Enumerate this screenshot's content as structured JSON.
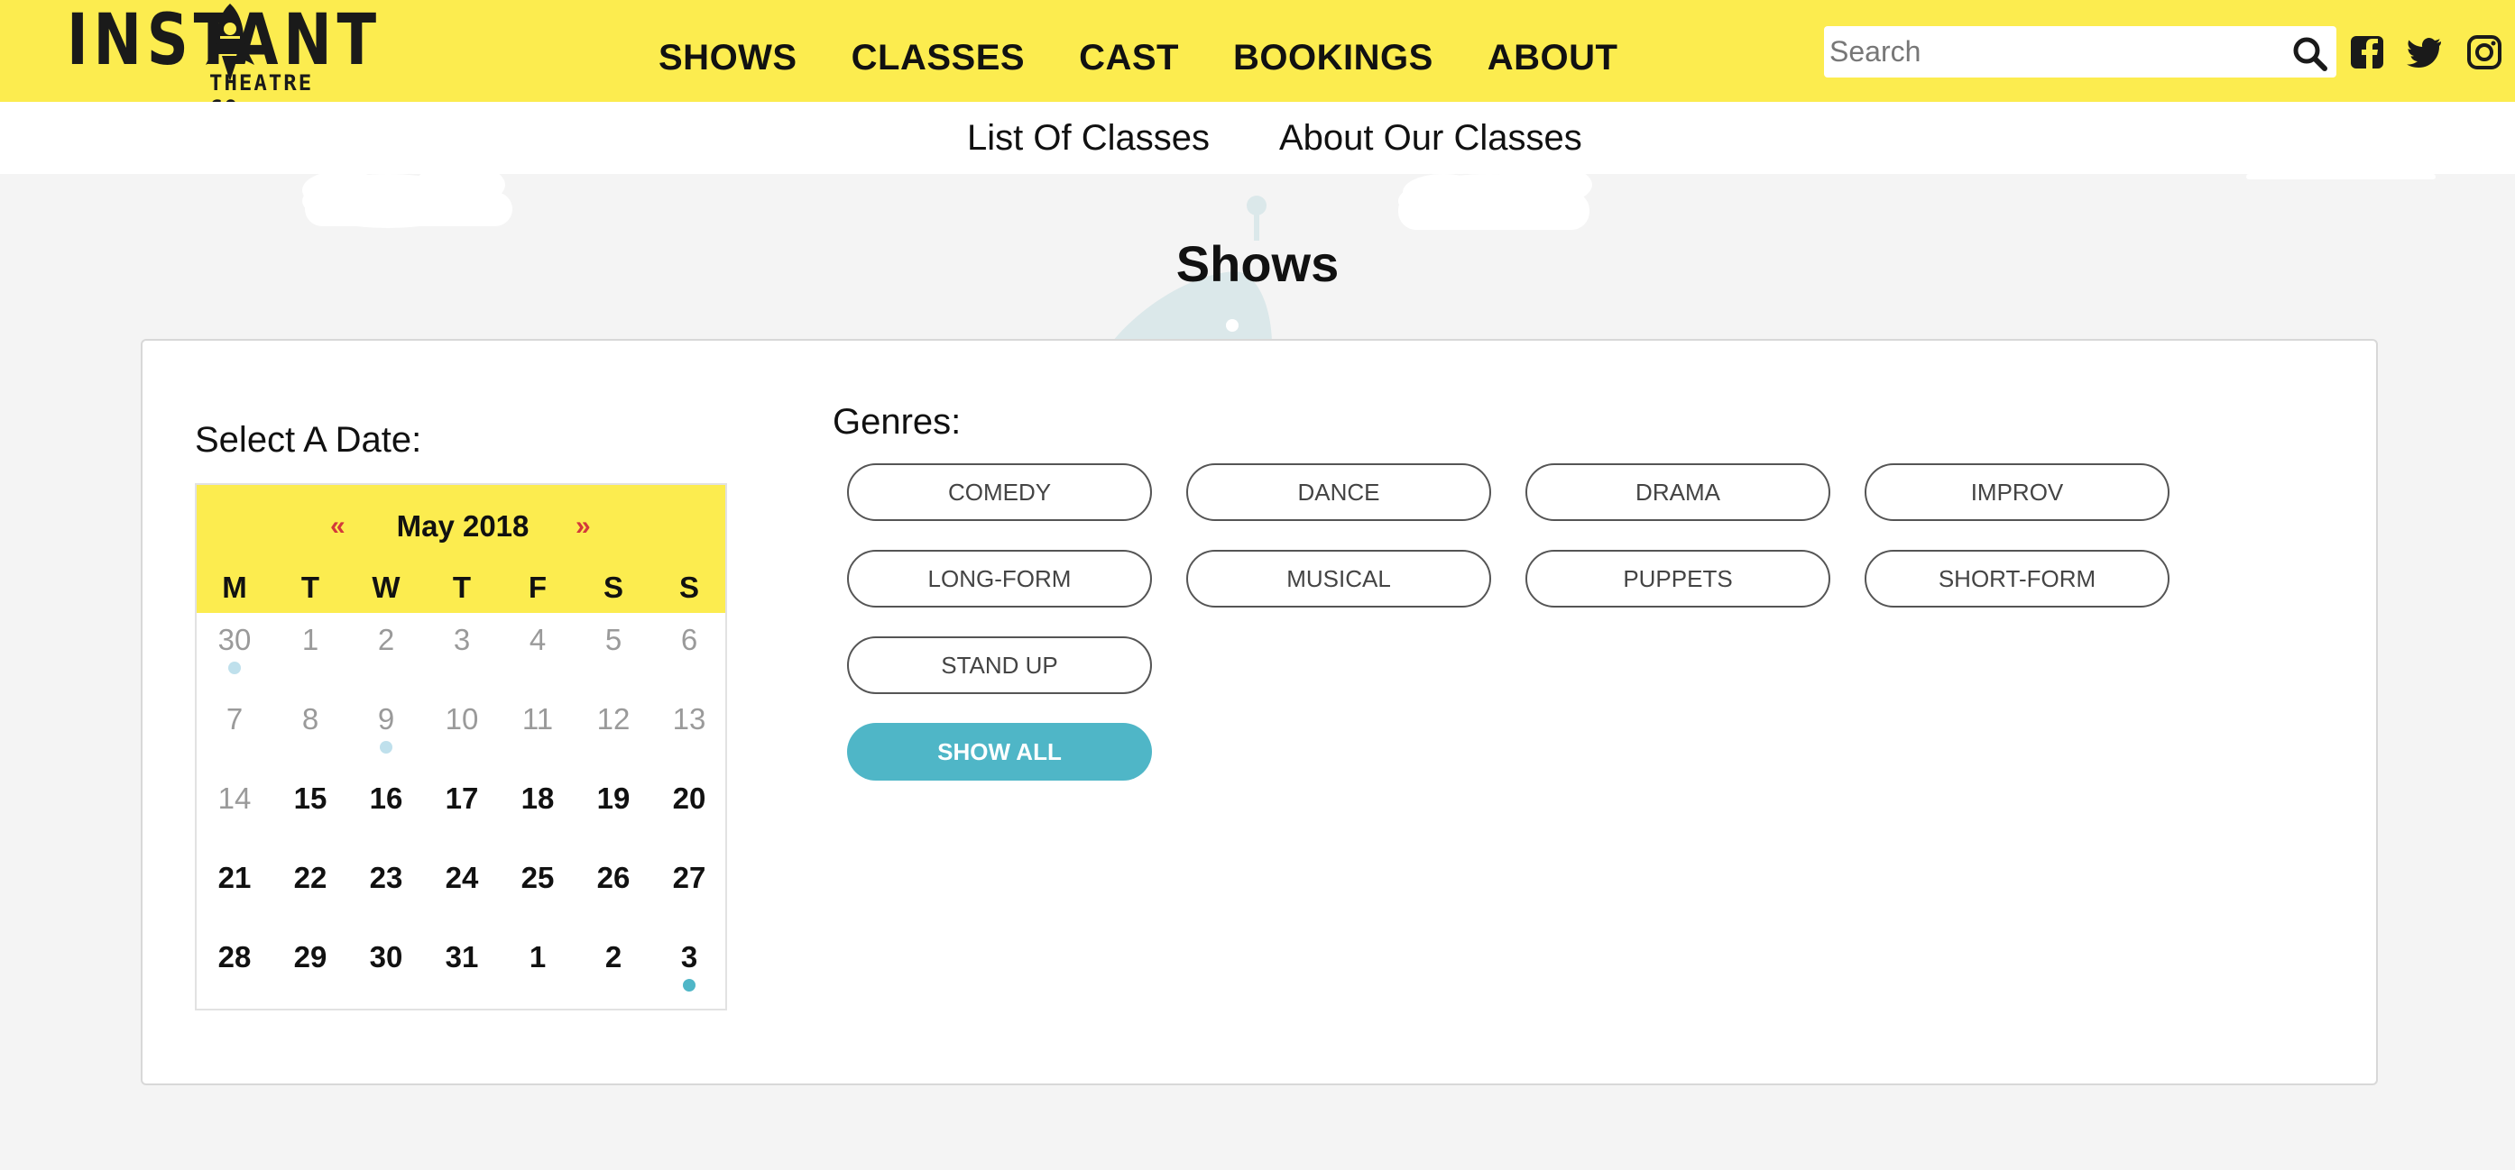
{
  "header": {
    "logo": {
      "word": "INSTANT",
      "sub": "THEATRE CO."
    },
    "nav": [
      {
        "label": "SHOWS"
      },
      {
        "label": "CLASSES"
      },
      {
        "label": "CAST"
      },
      {
        "label": "BOOKINGS"
      },
      {
        "label": "ABOUT"
      }
    ],
    "search": {
      "placeholder": "Search",
      "value": ""
    },
    "social_icons": [
      "facebook-icon",
      "twitter-icon",
      "instagram-icon"
    ]
  },
  "subnav": [
    {
      "label": "List Of Classes"
    },
    {
      "label": "About Our Classes"
    }
  ],
  "page": {
    "title": "Shows"
  },
  "date_picker": {
    "label": "Select A Date:",
    "prev_symbol": "«",
    "next_symbol": "»",
    "month": "May 2018",
    "weekdays": [
      "M",
      "T",
      "W",
      "T",
      "F",
      "S",
      "S"
    ],
    "weeks": [
      [
        {
          "d": "30",
          "state": "muted",
          "dot": "light"
        },
        {
          "d": "1",
          "state": "muted"
        },
        {
          "d": "2",
          "state": "muted"
        },
        {
          "d": "3",
          "state": "muted"
        },
        {
          "d": "4",
          "state": "muted"
        },
        {
          "d": "5",
          "state": "muted"
        },
        {
          "d": "6",
          "state": "muted"
        }
      ],
      [
        {
          "d": "7",
          "state": "muted"
        },
        {
          "d": "8",
          "state": "muted"
        },
        {
          "d": "9",
          "state": "muted",
          "dot": "light"
        },
        {
          "d": "10",
          "state": "muted"
        },
        {
          "d": "11",
          "state": "muted"
        },
        {
          "d": "12",
          "state": "muted"
        },
        {
          "d": "13",
          "state": "muted"
        }
      ],
      [
        {
          "d": "14",
          "state": "muted"
        },
        {
          "d": "15",
          "state": "active"
        },
        {
          "d": "16",
          "state": "active"
        },
        {
          "d": "17",
          "state": "active"
        },
        {
          "d": "18",
          "state": "active"
        },
        {
          "d": "19",
          "state": "active"
        },
        {
          "d": "20",
          "state": "active"
        }
      ],
      [
        {
          "d": "21",
          "state": "active"
        },
        {
          "d": "22",
          "state": "active"
        },
        {
          "d": "23",
          "state": "active"
        },
        {
          "d": "24",
          "state": "active"
        },
        {
          "d": "25",
          "state": "active"
        },
        {
          "d": "26",
          "state": "active"
        },
        {
          "d": "27",
          "state": "active"
        }
      ],
      [
        {
          "d": "28",
          "state": "active"
        },
        {
          "d": "29",
          "state": "active"
        },
        {
          "d": "30",
          "state": "active"
        },
        {
          "d": "31",
          "state": "active"
        },
        {
          "d": "1",
          "state": "active"
        },
        {
          "d": "2",
          "state": "active"
        },
        {
          "d": "3",
          "state": "active",
          "dot": "strong"
        }
      ]
    ]
  },
  "genres": {
    "label": "Genres:",
    "items": [
      {
        "label": "COMEDY"
      },
      {
        "label": "DANCE"
      },
      {
        "label": "DRAMA"
      },
      {
        "label": "IMPROV"
      },
      {
        "label": "LONG-FORM"
      },
      {
        "label": "MUSICAL"
      },
      {
        "label": "PUPPETS"
      },
      {
        "label": "SHORT-FORM"
      },
      {
        "label": "STAND UP"
      }
    ],
    "show_all": "SHOW ALL"
  },
  "colors": {
    "header_bg": "#fcec4f",
    "accent": "#4fb6c7",
    "nav_arrow": "#d33a3a",
    "page_bg": "#f4f4f4"
  }
}
